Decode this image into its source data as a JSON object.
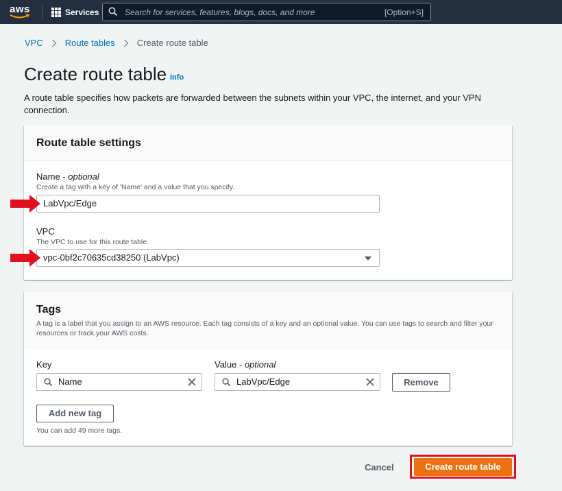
{
  "nav": {
    "logo_text": "aws",
    "services_label": "Services",
    "search_placeholder": "Search for services, features, blogs, docs, and more",
    "search_shortcut": "[Option+S]"
  },
  "breadcrumb": {
    "items": [
      "VPC",
      "Route tables"
    ],
    "current": "Create route table"
  },
  "page": {
    "title": "Create route table",
    "info": "Info",
    "description": "A route table specifies how packets are forwarded between the subnets within your VPC, the internet, and your VPN connection."
  },
  "settings": {
    "title": "Route table settings",
    "name_label": "Name - ",
    "name_optional": "optional",
    "name_desc": "Create a tag with a key of 'Name' and a value that you specify.",
    "name_value": "LabVpc/Edge",
    "vpc_label": "VPC",
    "vpc_desc": "The VPC to use for this route table.",
    "vpc_value": "vpc-0bf2c70635cd38250 (LabVpc)"
  },
  "tags": {
    "title": "Tags",
    "description": "A tag is a label that you assign to an AWS resource. Each tag consists of a key and an optional value. You can use tags to search and filter your resources or track your AWS costs.",
    "key_header": "Key",
    "value_header": "Value - ",
    "value_optional": "optional",
    "rows": [
      {
        "key": "Name",
        "value": "LabVpc/Edge",
        "remove": "Remove"
      }
    ],
    "add_label": "Add new tag",
    "limit_text": "You can add 49 more tags."
  },
  "footer": {
    "cancel": "Cancel",
    "create": "Create route table"
  },
  "colors": {
    "nav_bg": "#232f3e",
    "link": "#0073bb",
    "primary_button": "#ec7211",
    "annotation_red": "#e0101c"
  }
}
